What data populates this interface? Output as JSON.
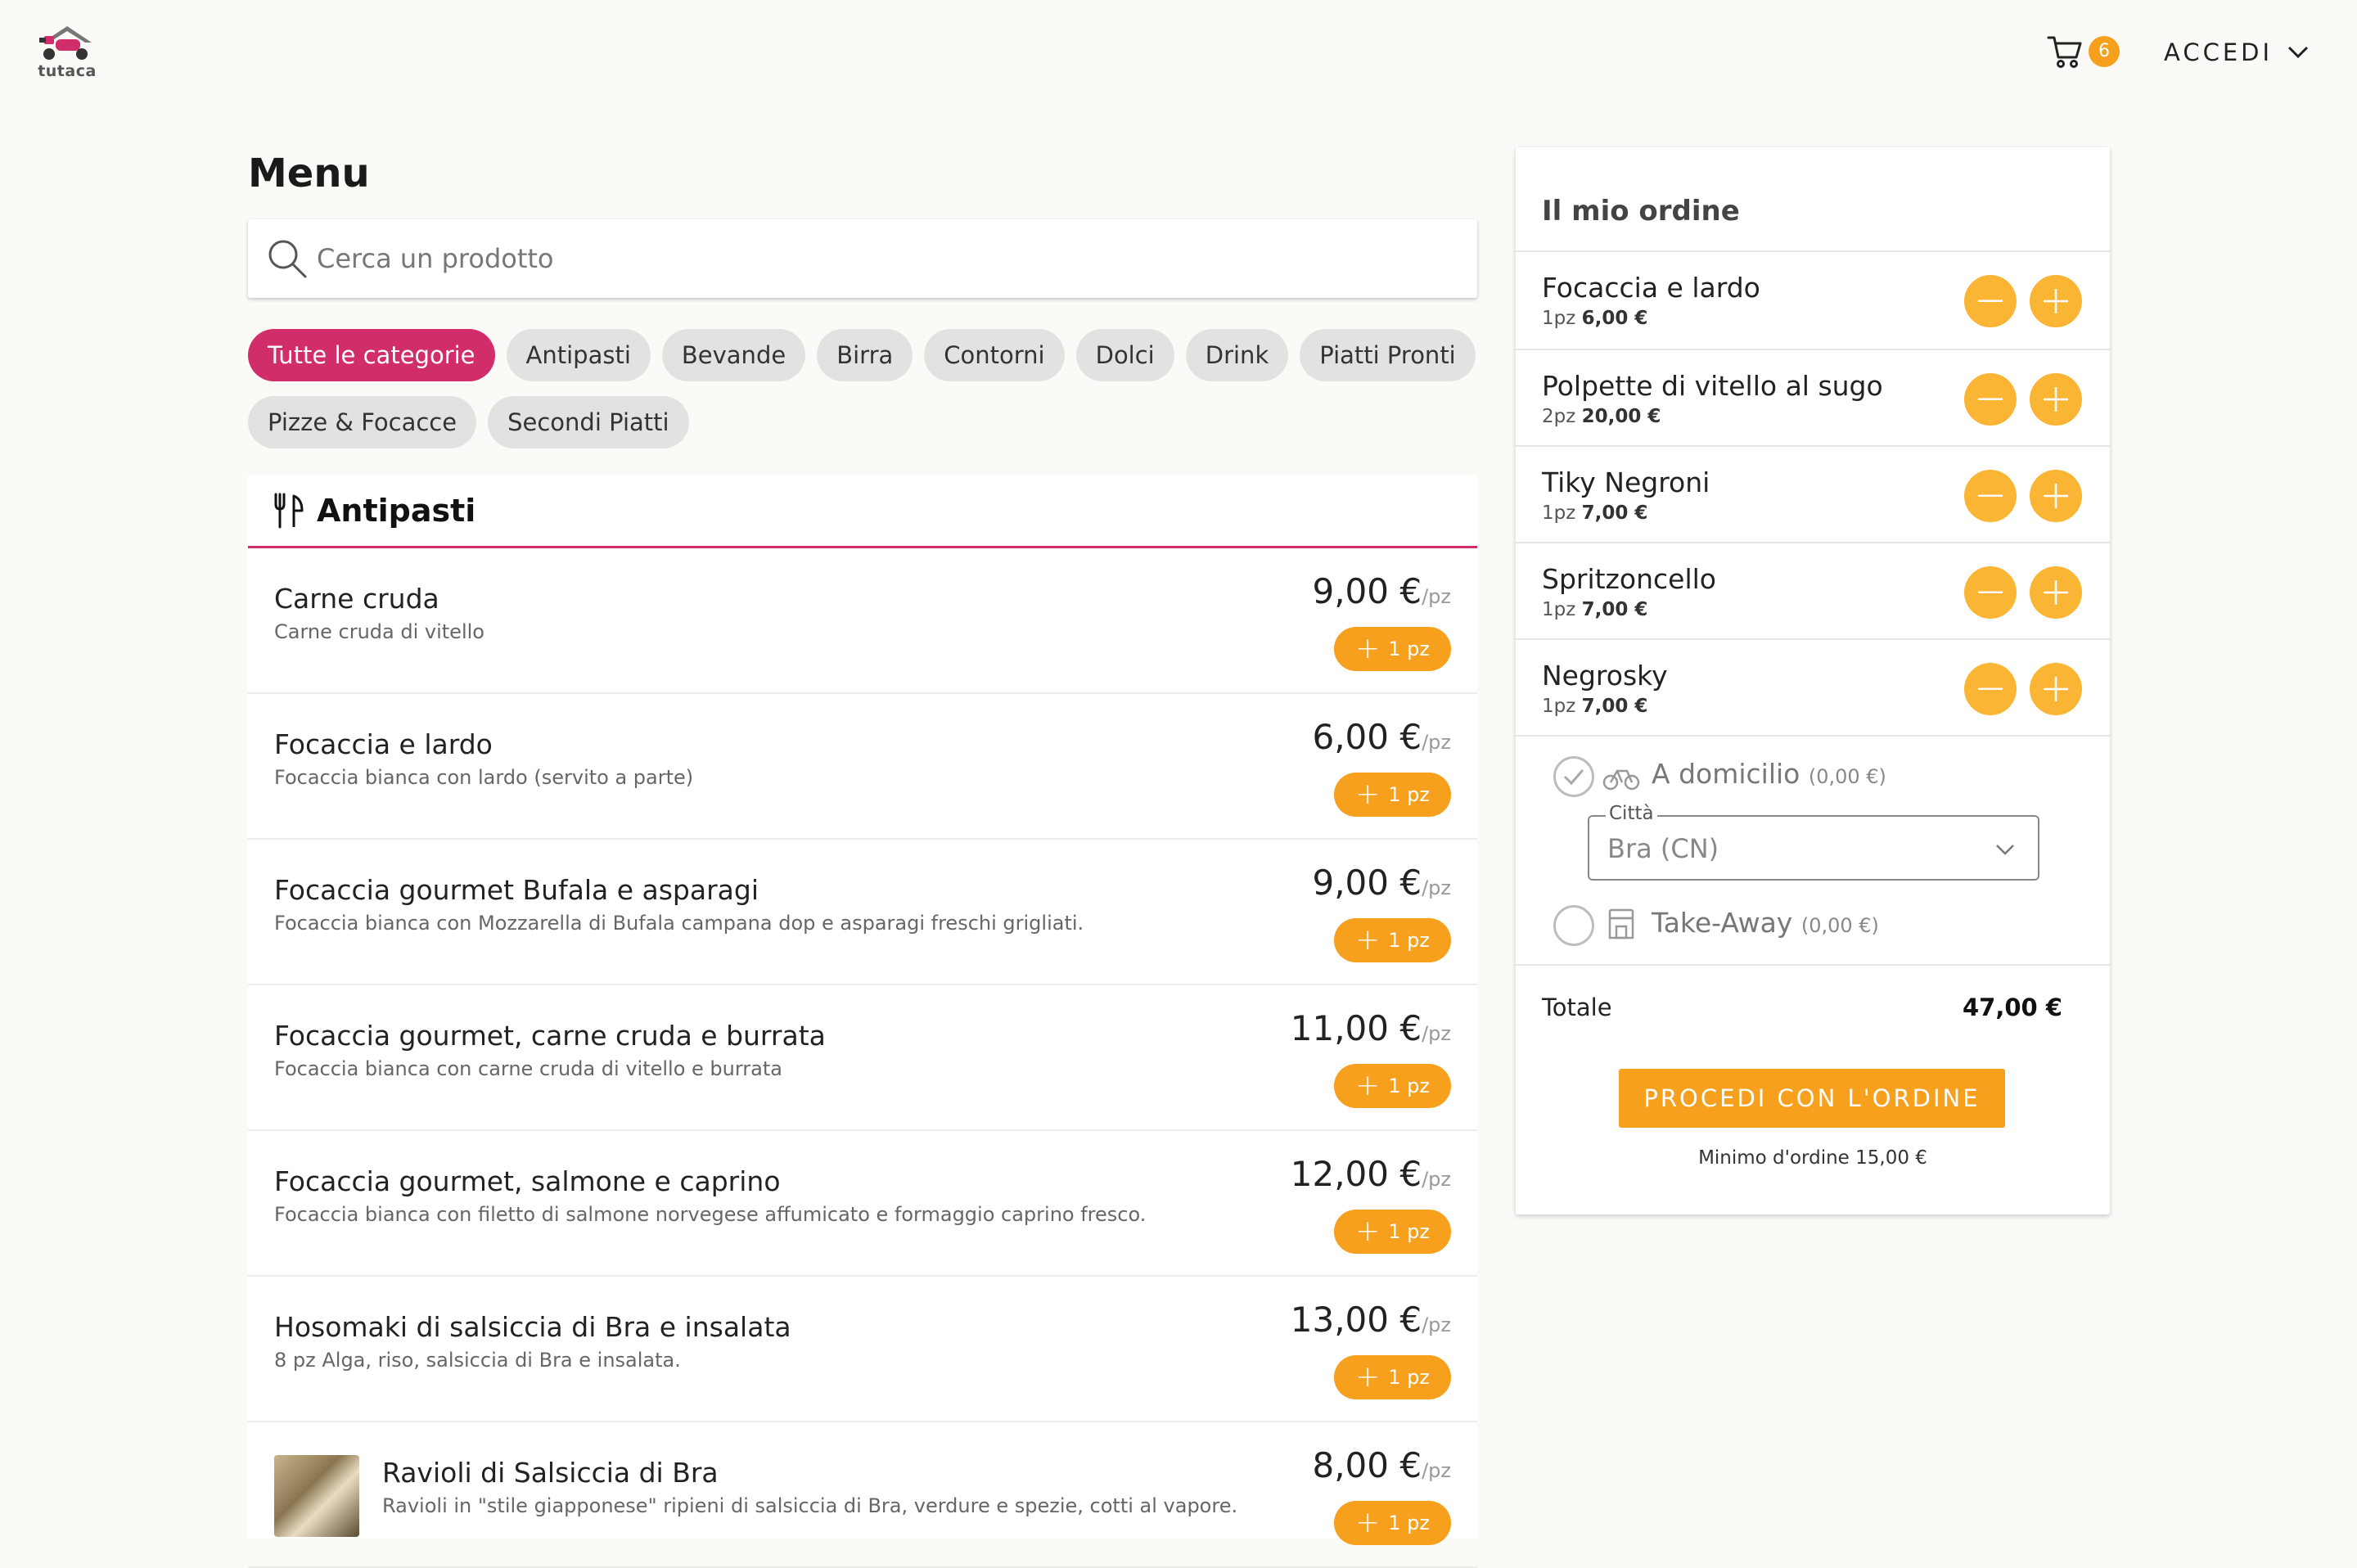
{
  "header": {
    "logo_text": "tutaca",
    "cart_count": "6",
    "login_label": "ACCEDI"
  },
  "menu": {
    "title": "Menu",
    "search_placeholder": "Cerca un prodotto",
    "categories": [
      "Tutte le categorie",
      "Antipasti",
      "Bevande",
      "Birra",
      "Contorni",
      "Dolci",
      "Drink",
      "Piatti Pronti",
      "Pizze & Focacce",
      "Secondi Piatti"
    ],
    "active_category": "Tutte le categorie",
    "section_title": "Antipasti",
    "items": [
      {
        "name": "Carne cruda",
        "desc": "Carne cruda di vitello",
        "price": "9,00 €",
        "unit": "/pz",
        "add": "1 pz"
      },
      {
        "name": "Focaccia e lardo",
        "desc": "Focaccia bianca con lardo (servito a parte)",
        "price": "6,00 €",
        "unit": "/pz",
        "add": "1 pz"
      },
      {
        "name": "Focaccia gourmet Bufala e asparagi",
        "desc": "Focaccia bianca con Mozzarella di Bufala campana dop e asparagi freschi grigliati.",
        "price": "9,00 €",
        "unit": "/pz",
        "add": "1 pz"
      },
      {
        "name": "Focaccia gourmet, carne cruda e burrata",
        "desc": "Focaccia bianca con carne cruda di vitello e burrata",
        "price": "11,00 €",
        "unit": "/pz",
        "add": "1 pz"
      },
      {
        "name": "Focaccia gourmet, salmone e caprino",
        "desc": "Focaccia bianca con filetto di salmone norvegese affumicato e formaggio caprino fresco.",
        "price": "12,00 €",
        "unit": "/pz",
        "add": "1 pz"
      },
      {
        "name": "Hosomaki di salsiccia di Bra e insalata",
        "desc": "8 pz Alga, riso, salsiccia di Bra e insalata.",
        "price": "13,00 €",
        "unit": "/pz",
        "add": "1 pz"
      },
      {
        "name": "Ravioli di Salsiccia di Bra",
        "desc": "Ravioli in \"stile giapponese\" ripieni di salsiccia di Bra, verdure e spezie, cotti al vapore.",
        "price": "8,00 €",
        "unit": "/pz",
        "add": "1 pz"
      }
    ]
  },
  "order": {
    "title": "Il mio ordine",
    "lines": [
      {
        "name": "Focaccia e lardo",
        "qty": "1pz",
        "amount": "6,00 €"
      },
      {
        "name": "Polpette di vitello al sugo",
        "qty": "2pz",
        "amount": "20,00 €"
      },
      {
        "name": "Tiky Negroni",
        "qty": "1pz",
        "amount": "7,00 €"
      },
      {
        "name": "Spritzoncello",
        "qty": "1pz",
        "amount": "7,00 €"
      },
      {
        "name": "Negrosky",
        "qty": "1pz",
        "amount": "7,00 €"
      }
    ],
    "delivery": {
      "label": "A domicilio",
      "fee": "(0,00 €)",
      "selected": true
    },
    "city": {
      "label": "Città",
      "value": "Bra (CN)"
    },
    "takeaway": {
      "label": "Take-Away",
      "fee": "(0,00 €)",
      "selected": false
    },
    "total_label": "Totale",
    "total_value": "47,00 €",
    "proceed_label": "PROCEDI CON L'ORDINE",
    "min_order": "Minimo d'ordine 15,00 €"
  },
  "colors": {
    "accent_pink": "#d22d6b",
    "accent_orange": "#f7a01d",
    "button_yellow": "#fbb535",
    "background": "#fcfaf7"
  }
}
